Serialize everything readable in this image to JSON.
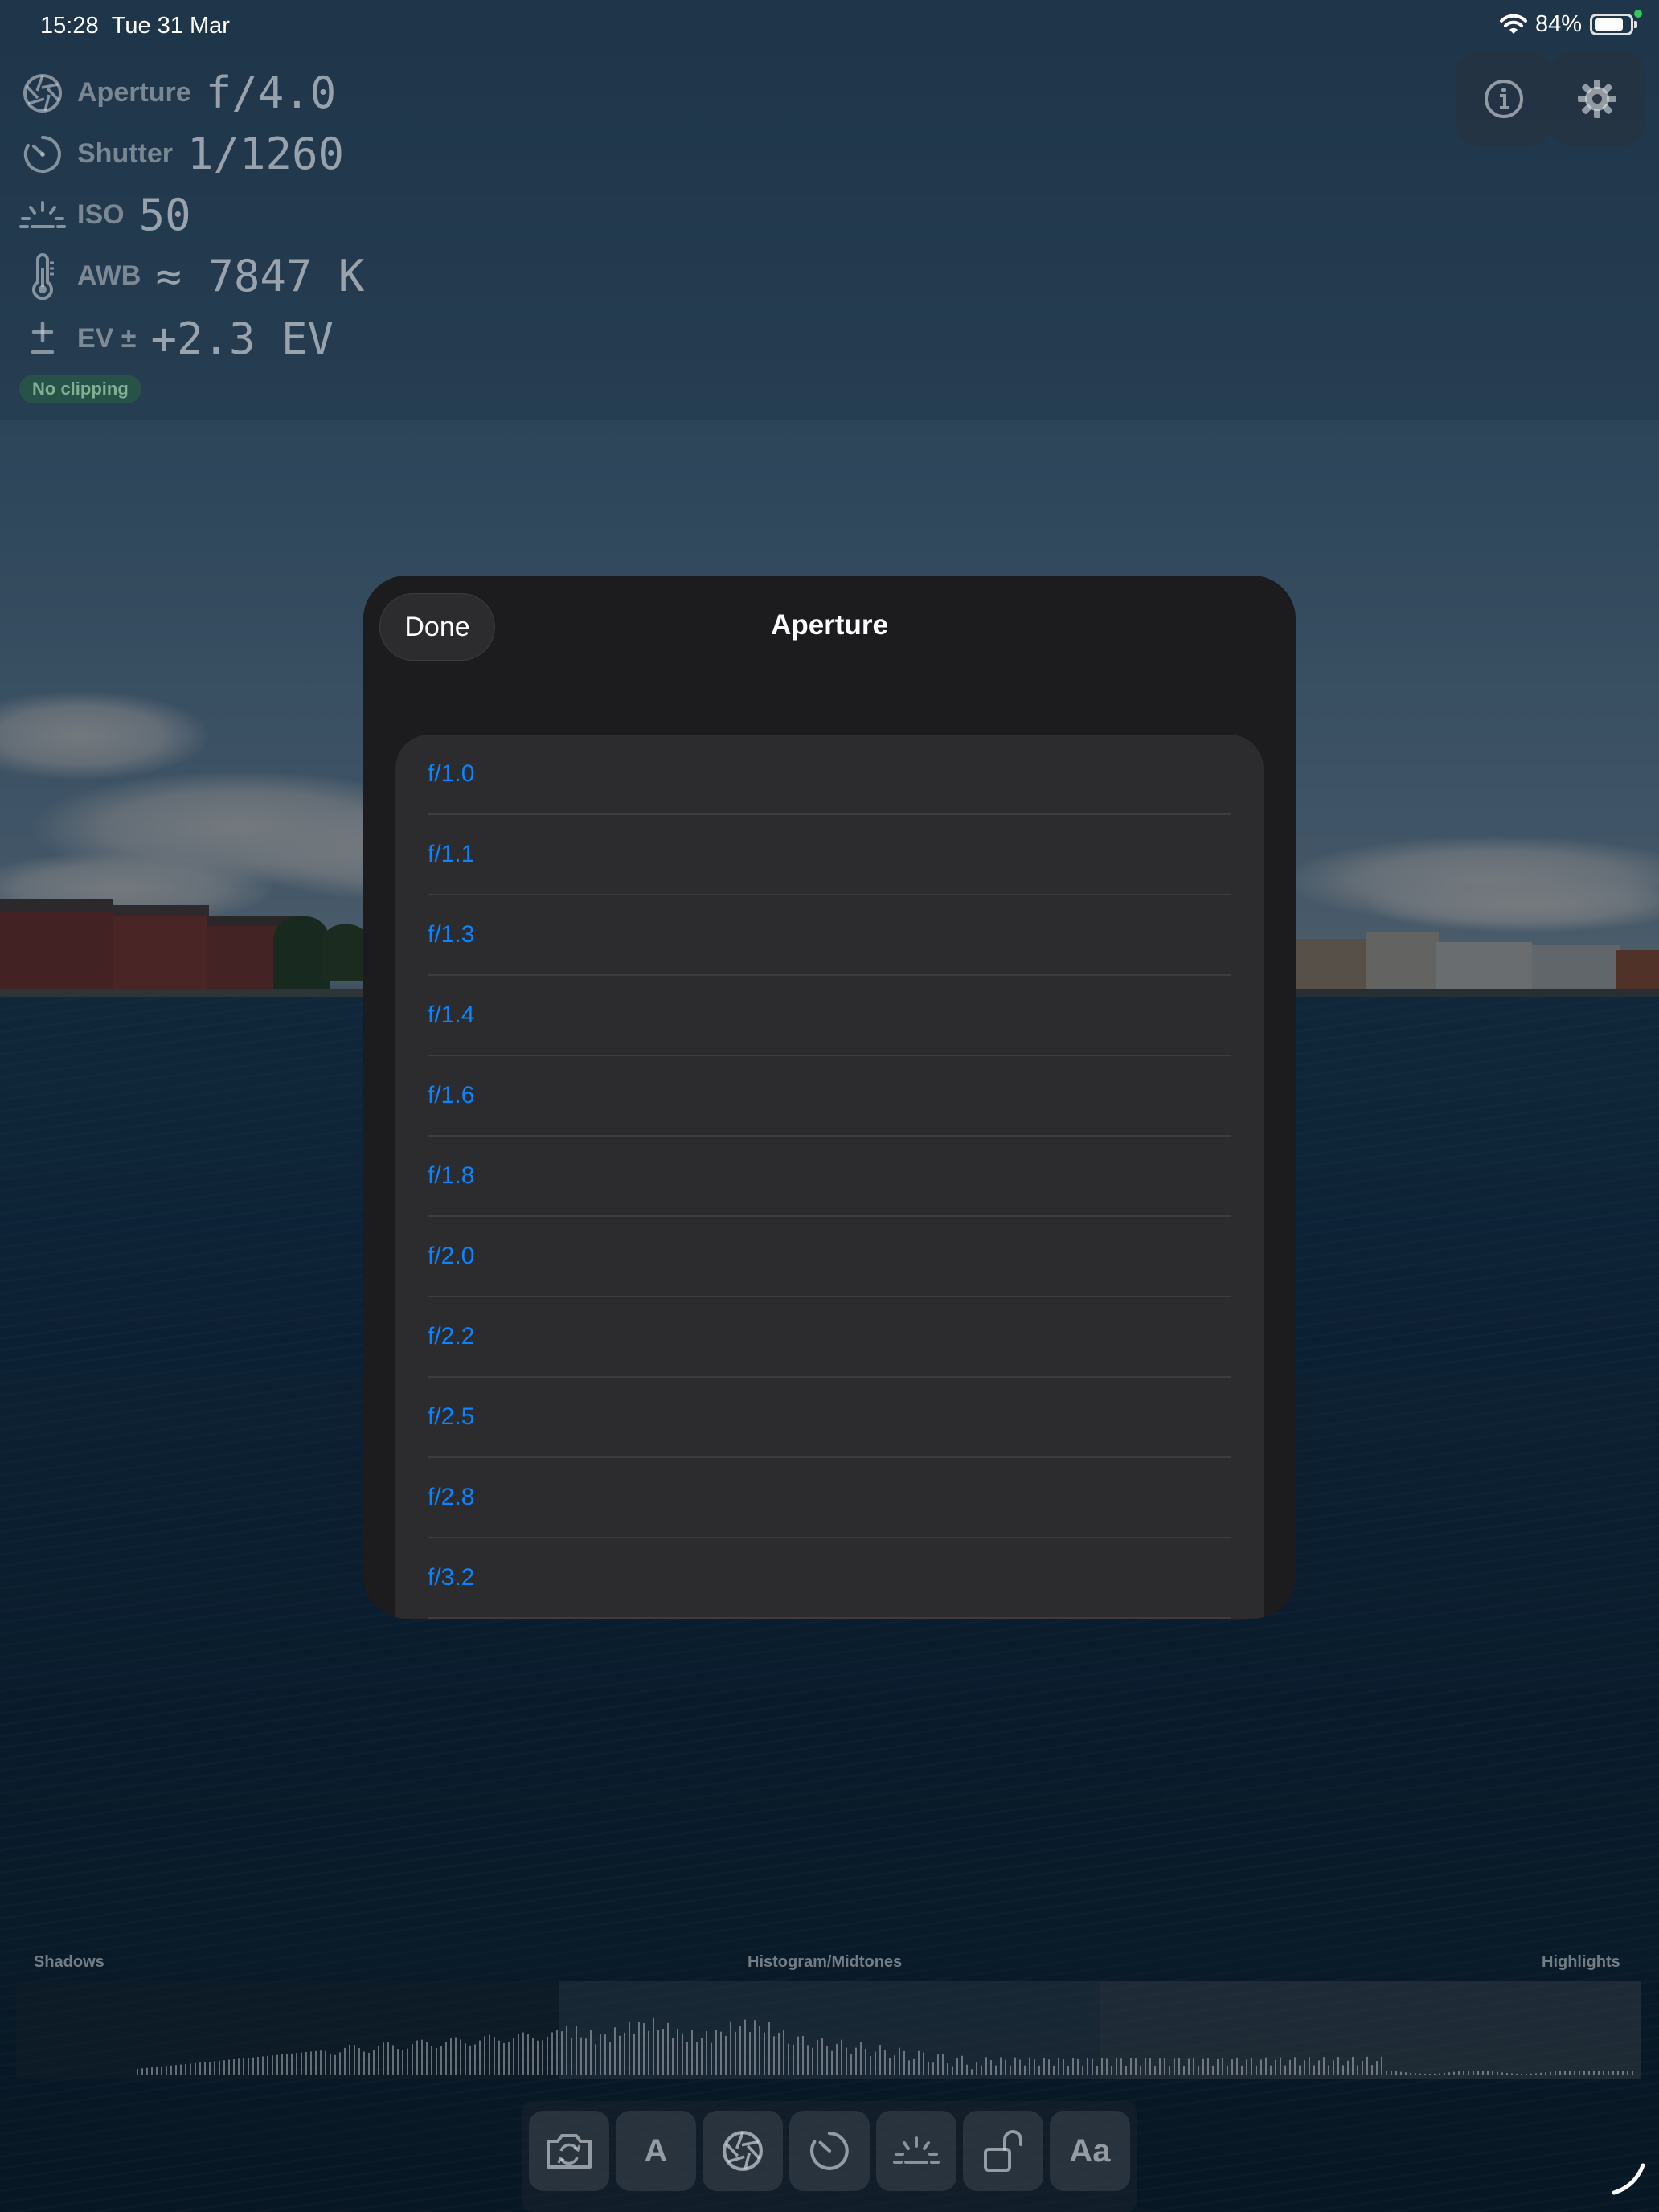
{
  "status_bar": {
    "time": "15:28",
    "date": "Tue 31 Mar",
    "battery_percent": "84%",
    "battery_level": 0.84
  },
  "readouts": [
    {
      "label": "Aperture",
      "value": "f/4.0",
      "icon": "aperture-icon"
    },
    {
      "label": "Shutter",
      "value": "1/1260",
      "icon": "shutter-timer-icon"
    },
    {
      "label": "ISO",
      "value": "50",
      "icon": "iso-sun-icon"
    },
    {
      "label": "AWB",
      "value": "≈ 7847 K",
      "icon": "thermometer-icon"
    },
    {
      "label": "EV ±",
      "value": "+2.3 EV",
      "icon": "plus-minus-icon"
    }
  ],
  "clipping_badge": "No clipping",
  "top_buttons": {
    "info": "info-icon",
    "settings": "gear-icon"
  },
  "sheet": {
    "done_label": "Done",
    "title": "Aperture",
    "options": [
      "f/1.0",
      "f/1.1",
      "f/1.3",
      "f/1.4",
      "f/1.6",
      "f/1.8",
      "f/2.0",
      "f/2.2",
      "f/2.5",
      "f/2.8",
      "f/3.2"
    ]
  },
  "histogram": {
    "shadows_label": "Shadows",
    "midtones_label": "Histogram/Midtones",
    "highlights_label": "Highlights"
  },
  "toolbar": {
    "auto_label": "A",
    "font_label": "Aa",
    "items": [
      "camera-switch-icon",
      "auto-mode-button",
      "aperture-icon",
      "shutter-icon",
      "iso-icon",
      "lock-icon",
      "text-size-button"
    ]
  },
  "colors": {
    "accent": "#0a84ff",
    "sheet_background": "#1c1c1e",
    "list_background": "#2c2c2e",
    "clipping_badge": "#2a6a50"
  }
}
